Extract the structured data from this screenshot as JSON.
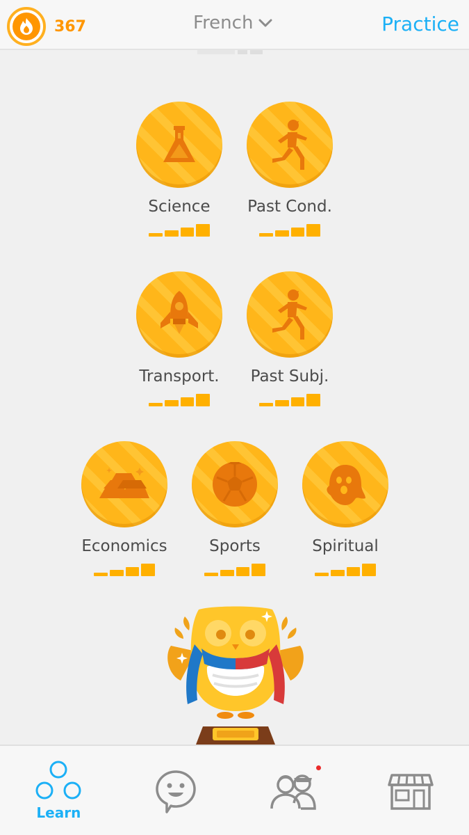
{
  "header": {
    "streak_count": "367",
    "language": "French",
    "practice_label": "Practice"
  },
  "skills": [
    {
      "label": "Science",
      "icon": "flask-icon"
    },
    {
      "label": "Past Cond.",
      "icon": "runner-icon"
    },
    {
      "label": "Transport.",
      "icon": "rocket-icon"
    },
    {
      "label": "Past Subj.",
      "icon": "runner-icon"
    },
    {
      "label": "Economics",
      "icon": "gold-bars-icon"
    },
    {
      "label": "Sports",
      "icon": "soccer-ball-icon"
    },
    {
      "label": "Spiritual",
      "icon": "ghost-icon"
    }
  ],
  "bottom_nav": {
    "learn_label": "Learn",
    "items": [
      "learn-icon",
      "chat-bubble-icon",
      "friends-icon",
      "shop-icon"
    ]
  },
  "colors": {
    "gold": "#ffb61a",
    "accent_blue": "#1cb0f6",
    "streak_orange": "#ff9600"
  }
}
